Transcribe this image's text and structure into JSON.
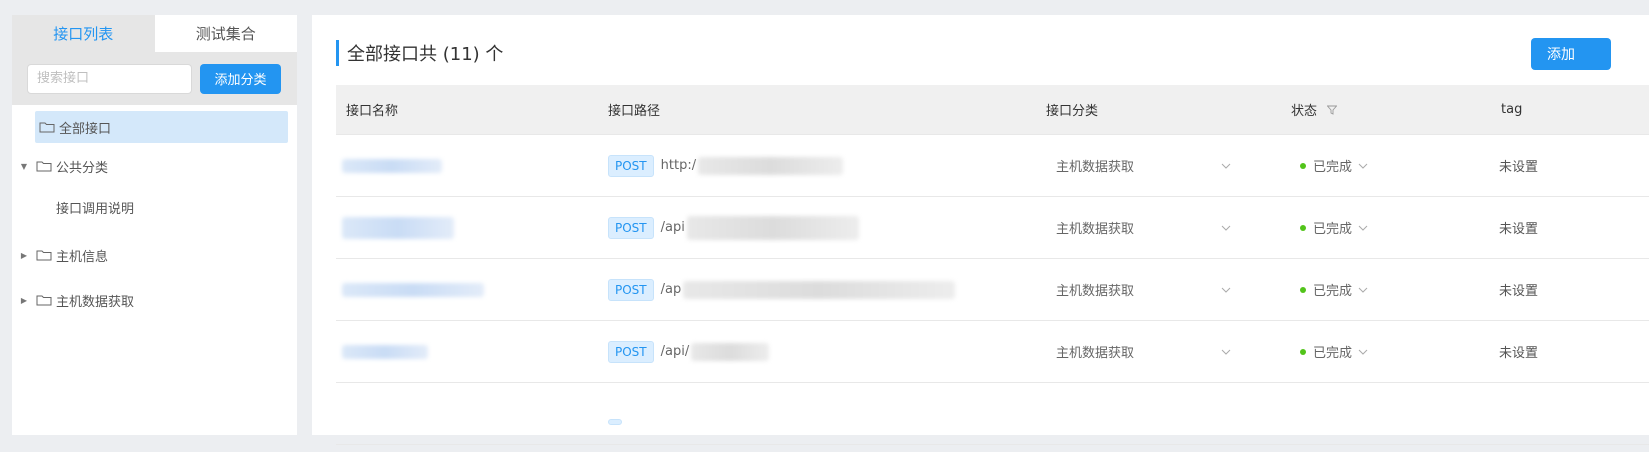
{
  "sidebar": {
    "tabs": [
      {
        "label": "接口列表",
        "active": true
      },
      {
        "label": "测试集合",
        "active": false
      }
    ],
    "search": {
      "placeholder": "搜索接口",
      "value": ""
    },
    "add_category_label": "添加分类",
    "tree": [
      {
        "label": "全部接口",
        "selected": true,
        "caret": false
      },
      {
        "label": "公共分类",
        "caret": "expanded"
      },
      {
        "label": "接口调用说明",
        "child": true
      },
      {
        "label": "主机信息",
        "caret": "collapsed"
      },
      {
        "label": "主机数据获取",
        "caret": "collapsed"
      }
    ]
  },
  "main": {
    "title": "全部接口共 (11) 个",
    "add_button_label": "添加",
    "table": {
      "headers": [
        "接口名称",
        "接口路径",
        "接口分类",
        "状态",
        "tag"
      ],
      "rows": [
        {
          "method": "POST",
          "path": "http:/",
          "category": "主机数据获取",
          "status": "已完成",
          "tag": "未设置"
        },
        {
          "method": "POST",
          "path": "/api",
          "category": "主机数据获取",
          "status": "已完成",
          "tag": "未设置"
        },
        {
          "method": "POST",
          "path": "/ap",
          "category": "主机数据获取",
          "status": "已完成",
          "tag": "未设置"
        },
        {
          "method": "POST",
          "path": "/api/",
          "category": "主机数据获取",
          "status": "已完成",
          "tag": "未设置"
        }
      ]
    }
  },
  "colors": {
    "accent": "#2395f1",
    "status_done": "#52c41a",
    "selected_bg": "#d4e8fa"
  }
}
